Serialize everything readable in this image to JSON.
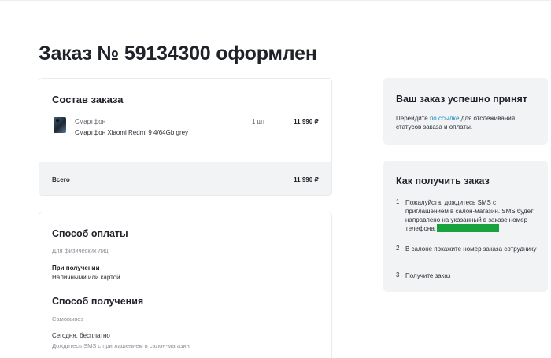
{
  "page": {
    "title": "Заказ № 59134300 оформлен"
  },
  "order": {
    "section_title": "Состав заказа",
    "item": {
      "category": "Смартфон",
      "name": "Смартфон Xiaomi Redmi 9 4/64Gb grey",
      "quantity": "1 шт",
      "price": "11 990 ₽",
      "thumbnail_icon": "smartphone-thumbnail"
    },
    "total_label": "Всего",
    "total_value": "11 990 ₽"
  },
  "payment": {
    "section_title": "Способ оплаты",
    "customer_type": "Для физических лиц",
    "option_title": "При получении",
    "option_value": "Наличными или картой"
  },
  "delivery": {
    "section_title": "Способ получения",
    "method": "Самовывоз",
    "when": "Сегодня, бесплатно",
    "note": "Дождитесь SMS с приглашением в салон-магазин"
  },
  "success": {
    "title": "Ваш заказ успешно принят",
    "text_before_link": "Перейдите ",
    "link_text": "по ссылке",
    "text_after_link": " для отслеживания статусов заказа и оплаты."
  },
  "howto": {
    "title": "Как получить заказ",
    "steps": [
      {
        "num": "1",
        "text": "Пожалуйста, дождитесь SMS с приглашением в салон-магазин. SMS будет направлено на указанный в заказе номер телефона:"
      },
      {
        "num": "2",
        "text": "В салоне покажите номер заказа сотруднику"
      },
      {
        "num": "3",
        "text": "Получите заказ"
      }
    ],
    "redaction_color": "#18a33f"
  },
  "colors": {
    "link": "#1d8ac9",
    "card_gray": "#f2f3f5"
  }
}
